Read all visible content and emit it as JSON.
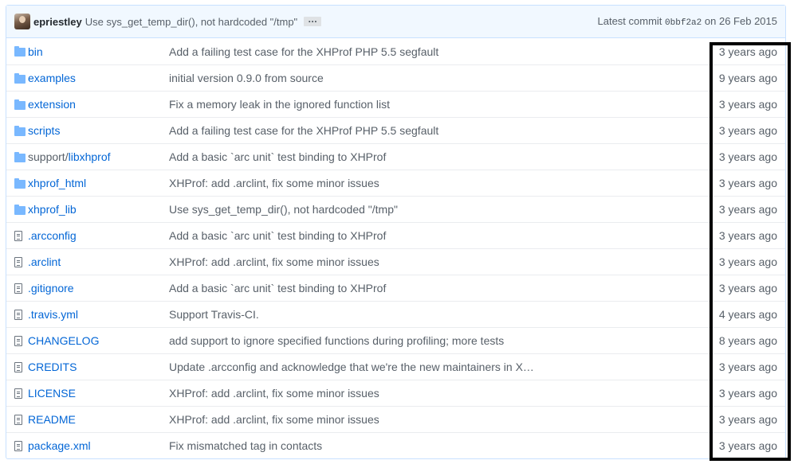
{
  "commit": {
    "author": "epriestley",
    "message": "Use sys_get_temp_dir(), not hardcoded \"/tmp\"",
    "ellipsis": "…",
    "latest_label": "Latest commit",
    "sha": "0bbf2a2",
    "on_label": "on",
    "date": "26 Feb 2015"
  },
  "files": [
    {
      "type": "folder",
      "name": "bin",
      "message": "Add a failing test case for the XHProf PHP 5.5 segfault",
      "age": "3 years ago"
    },
    {
      "type": "folder",
      "name": "examples",
      "message": "initial version 0.9.0 from source",
      "age": "9 years ago"
    },
    {
      "type": "folder",
      "name": "extension",
      "message": "Fix a memory leak in the ignored function list",
      "age": "3 years ago"
    },
    {
      "type": "folder",
      "name": "scripts",
      "message": "Add a failing test case for the XHProf PHP 5.5 segfault",
      "age": "3 years ago"
    },
    {
      "type": "folder",
      "prefix": "support/",
      "name": "libxhprof",
      "message": "Add a basic `arc unit` test binding to XHProf",
      "age": "3 years ago"
    },
    {
      "type": "folder",
      "name": "xhprof_html",
      "message": "XHProf: add .arclint, fix some minor issues",
      "age": "3 years ago"
    },
    {
      "type": "folder",
      "name": "xhprof_lib",
      "message": "Use sys_get_temp_dir(), not hardcoded \"/tmp\"",
      "age": "3 years ago"
    },
    {
      "type": "file",
      "name": ".arcconfig",
      "message": "Add a basic `arc unit` test binding to XHProf",
      "age": "3 years ago"
    },
    {
      "type": "file",
      "name": ".arclint",
      "message": "XHProf: add .arclint, fix some minor issues",
      "age": "3 years ago"
    },
    {
      "type": "file",
      "name": ".gitignore",
      "message": "Add a basic `arc unit` test binding to XHProf",
      "age": "3 years ago"
    },
    {
      "type": "file",
      "name": ".travis.yml",
      "message": "Support Travis-CI.",
      "age": "4 years ago"
    },
    {
      "type": "file",
      "name": "CHANGELOG",
      "message": "add support to ignore specified functions during profiling; more tests",
      "age": "8 years ago"
    },
    {
      "type": "file",
      "name": "CREDITS",
      "message": "Update .arcconfig and acknowledge that we're the new maintainers in X…",
      "age": "3 years ago"
    },
    {
      "type": "file",
      "name": "LICENSE",
      "message": "XHProf: add .arclint, fix some minor issues",
      "age": "3 years ago"
    },
    {
      "type": "file",
      "name": "README",
      "message": "XHProf: add .arclint, fix some minor issues",
      "age": "3 years ago"
    },
    {
      "type": "file",
      "name": "package.xml",
      "message": "Fix mismatched tag in contacts",
      "age": "3 years ago"
    }
  ],
  "colors": {
    "link": "#0366d6",
    "muted": "#586069",
    "folder_icon": "#79b8ff",
    "commit_bar_bg": "#f1f8ff",
    "border": "#c8e1ff",
    "highlight": "#000000"
  }
}
